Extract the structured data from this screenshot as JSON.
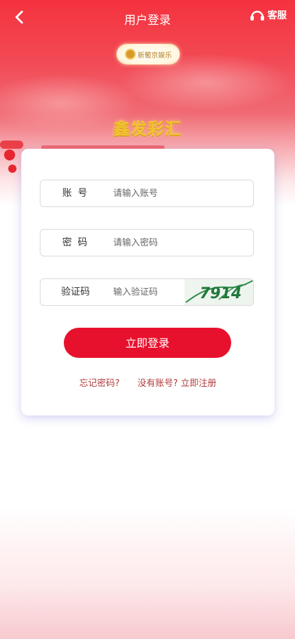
{
  "header": {
    "title": "用户登录",
    "service_label": "客服"
  },
  "brand": {
    "logo_text": "新葡京娱乐",
    "name": "鑫发彩汇"
  },
  "form": {
    "account": {
      "label": "账 号",
      "placeholder": "请输入账号",
      "value": ""
    },
    "password": {
      "label": "密 码",
      "placeholder": "请输入密码",
      "value": ""
    },
    "captcha": {
      "label": "验证码",
      "placeholder": "输入验证码",
      "value": "",
      "image_text": "7914"
    },
    "submit_label": "立即登录",
    "forgot_label": "忘记密码?",
    "register_label": "没有账号? 立即注册"
  },
  "colors": {
    "accent": "#e8112d",
    "link": "#b23a3a",
    "captcha_digits": "#1f7a3a"
  },
  "icons": {
    "back": "chevron-left-icon",
    "service": "headset-icon"
  }
}
